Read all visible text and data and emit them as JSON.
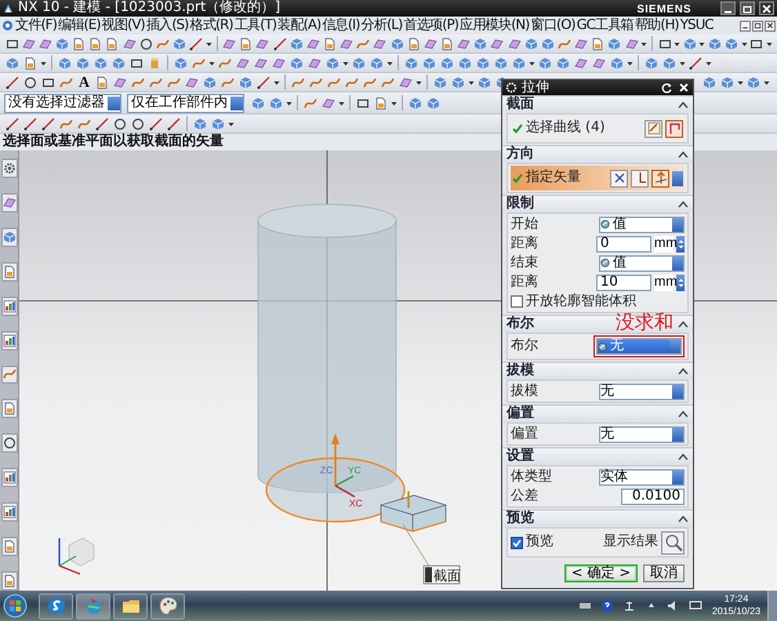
{
  "window": {
    "title": "NX 10 - 建模 - [1023003.prt（修改的）]",
    "brand": "SIEMENS"
  },
  "menu": [
    "文件(F)",
    "编辑(E)",
    "视图(V)",
    "插入(S)",
    "格式(R)",
    "工具(T)",
    "装配(A)",
    "信息(I)",
    "分析(L)",
    "首选项(P)",
    "应用模块(N)",
    "窗口(O)",
    "GC工具箱",
    "帮助(H)",
    "YSUC"
  ],
  "toolbar_text_icon": "A",
  "selection_bar": {
    "type_filter": "没有选择过滤器",
    "scope": "仅在工作部件内"
  },
  "cue_line": "选择面或基准平面以获取截面的矢量",
  "graphics": {
    "section_tag": "截面",
    "axes": [
      "ZC",
      "YC",
      "XC"
    ]
  },
  "dialog": {
    "title": "拉伸",
    "groups": [
      {
        "title": "截面",
        "expanded": true,
        "rows": [
          {
            "kind": "select",
            "label": "选择曲线 (4)",
            "done": true,
            "highlighted": false
          }
        ]
      },
      {
        "title": "方向",
        "expanded": true,
        "rows": [
          {
            "kind": "select",
            "label": "指定矢量",
            "done": true,
            "highlighted": true
          }
        ]
      },
      {
        "title": "限制",
        "expanded": true,
        "rows": [
          {
            "kind": "dropdown",
            "label": "开始",
            "value": "值",
            "icon": true,
            "focused": false,
            "annotated": false
          },
          {
            "kind": "number",
            "label": "距离",
            "value": "0",
            "unit": "mm"
          },
          {
            "kind": "dropdown",
            "label": "结束",
            "value": "值",
            "icon": true,
            "focused": false,
            "annotated": false
          },
          {
            "kind": "number",
            "label": "距离",
            "value": "10",
            "unit": "mm"
          },
          {
            "kind": "checkbox",
            "label": "开放轮廓智能体积",
            "checked": false
          }
        ]
      },
      {
        "title": "布尔",
        "note": "没求和",
        "expanded": true,
        "rows": [
          {
            "kind": "dropdown",
            "label": "布尔",
            "value": "无",
            "icon": true,
            "focused": true,
            "annotated": true
          }
        ]
      },
      {
        "title": "拔模",
        "expanded": true,
        "rows": [
          {
            "kind": "dropdown",
            "label": "拔模",
            "value": "无",
            "icon": false,
            "focused": false,
            "annotated": false
          }
        ]
      },
      {
        "title": "偏置",
        "expanded": true,
        "rows": [
          {
            "kind": "dropdown",
            "label": "偏置",
            "value": "无",
            "icon": false,
            "focused": false,
            "annotated": false
          }
        ]
      },
      {
        "title": "设置",
        "expanded": true,
        "rows": [
          {
            "kind": "dropdown",
            "label": "体类型",
            "value": "实体",
            "icon": false,
            "focused": false,
            "annotated": false
          },
          {
            "kind": "number",
            "label": "公差",
            "value": "0.0100"
          }
        ]
      },
      {
        "title": "预览",
        "expanded": true,
        "rows": [
          {
            "kind": "preview",
            "label": "预览",
            "checked": true,
            "action": "显示结果"
          }
        ]
      }
    ],
    "buttons": [
      {
        "label": "< 确定 >",
        "default": true
      },
      {
        "label": "取消",
        "default": false
      }
    ]
  },
  "taskbar": {
    "time": "17:24",
    "date": "2015/10/23"
  }
}
